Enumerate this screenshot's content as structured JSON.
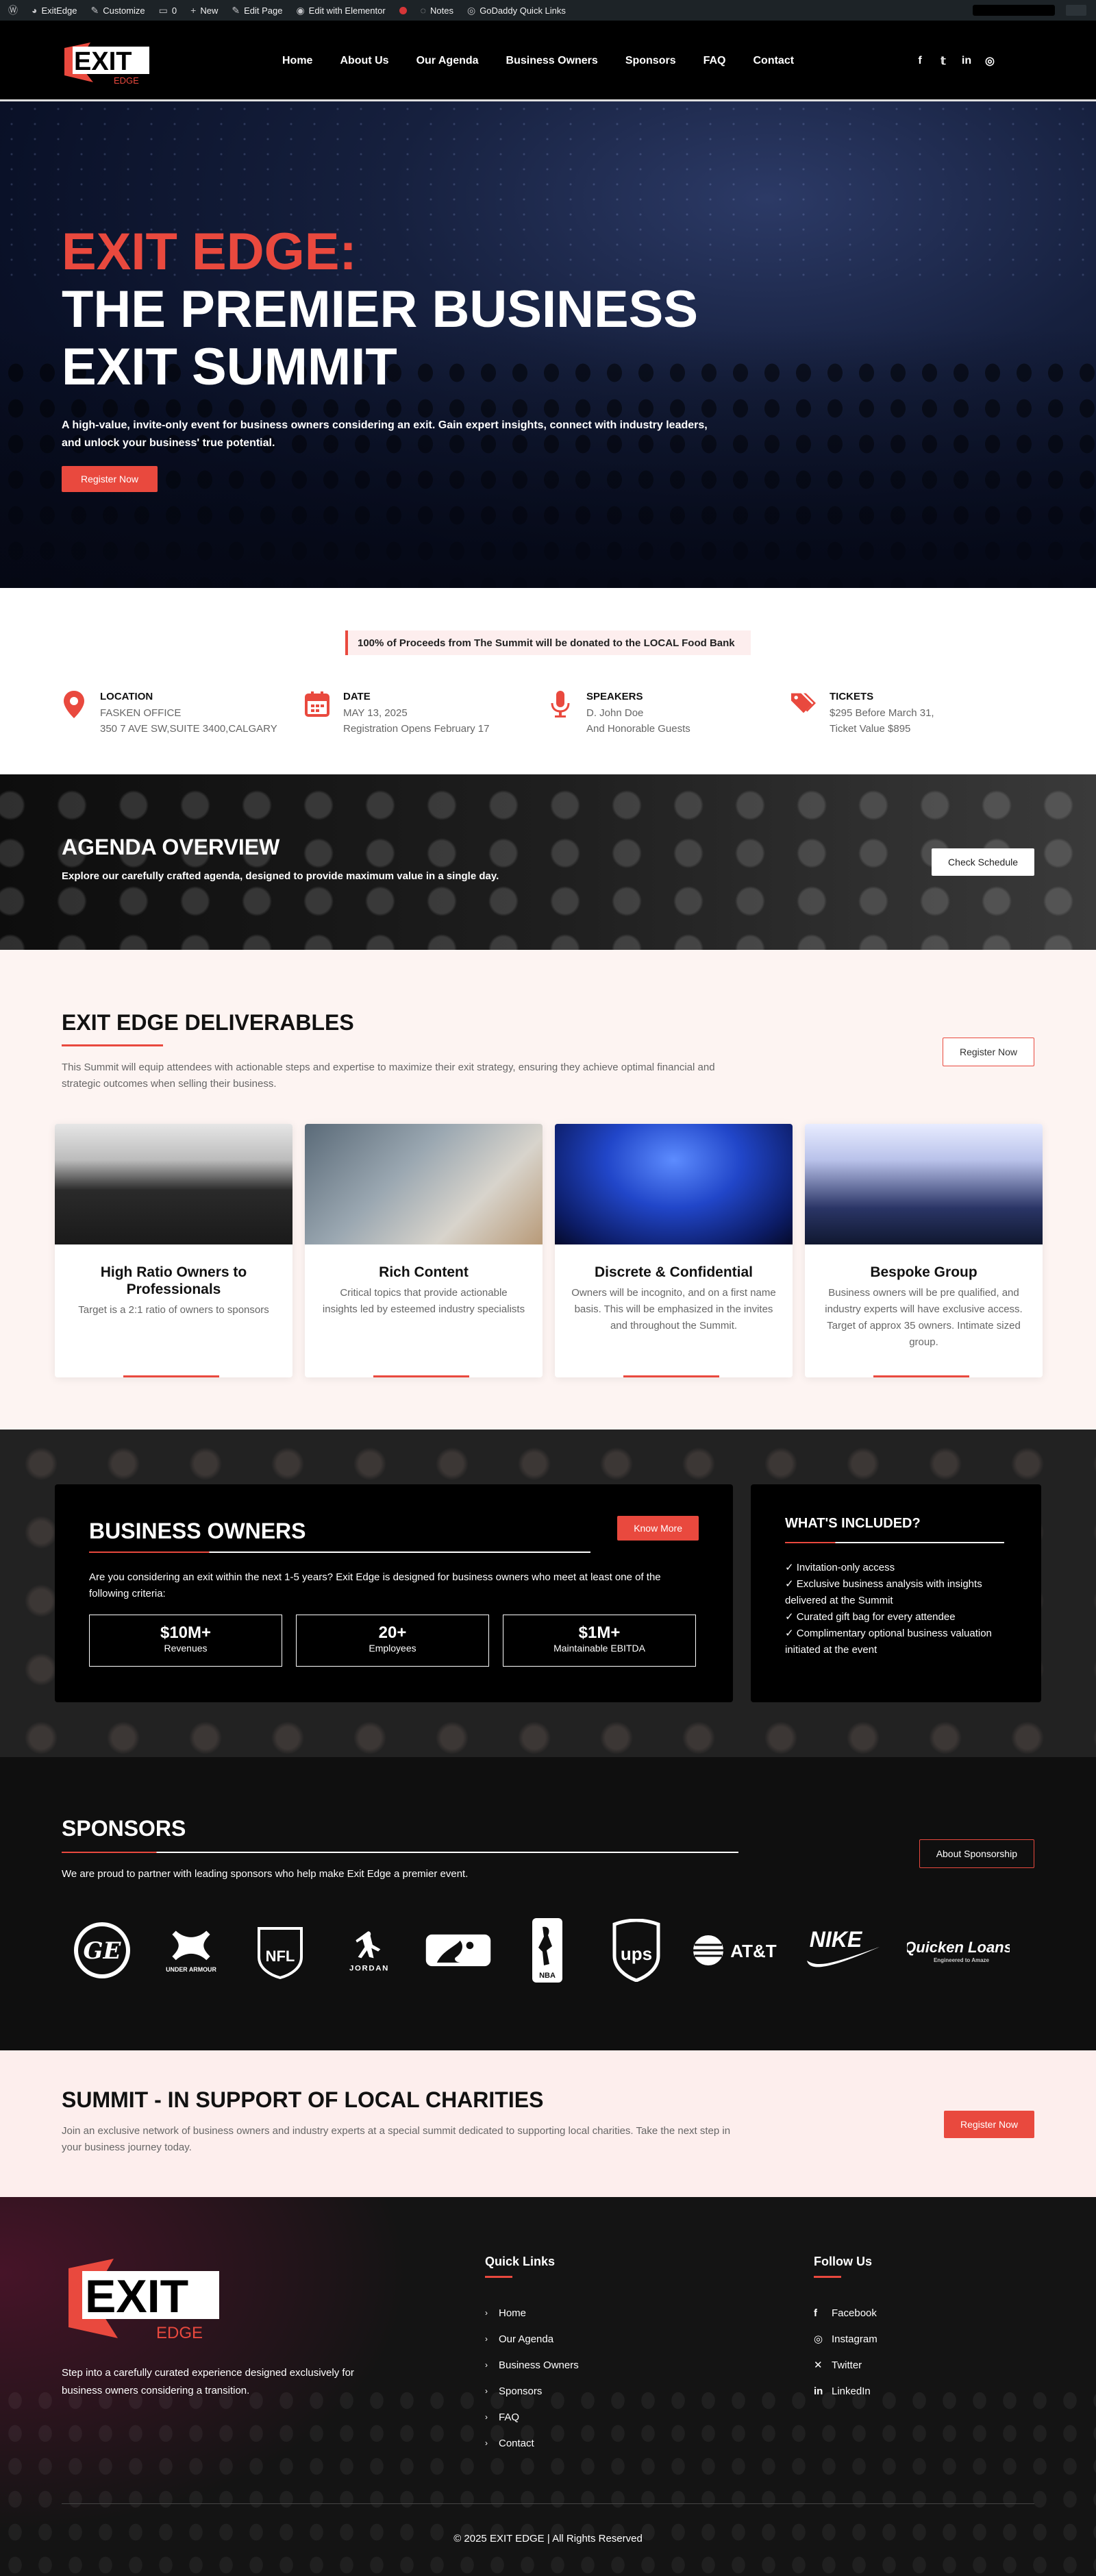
{
  "admin_bar": {
    "site": "ExitEdge",
    "customize": "Customize",
    "comments": "0",
    "new": "New",
    "edit_page": "Edit Page",
    "elementor": "Edit with Elementor",
    "notes": "Notes",
    "quick_links": "GoDaddy Quick Links"
  },
  "header": {
    "logo_main": "EXIT",
    "logo_sub": "EDGE",
    "nav": [
      "Home",
      "About Us",
      "Our Agenda",
      "Business Owners",
      "Sponsors",
      "FAQ",
      "Contact"
    ],
    "social_icons": [
      "facebook-icon",
      "twitter-icon",
      "linkedin-icon",
      "instagram-icon"
    ]
  },
  "hero": {
    "line1": "EXIT EDGE:",
    "line2": "THE PREMIER BUSINESS",
    "line3": "EXIT SUMMIT",
    "description": "A high-value, invite-only event for business owners considering an exit. Gain expert insights, connect with industry leaders, and unlock your business' true potential.",
    "cta": "Register Now"
  },
  "info": {
    "banner": "100% of Proceeds from The Summit will be donated to the LOCAL Food Bank",
    "items": [
      {
        "icon": "location-pin-icon",
        "title": "LOCATION",
        "line1": "FASKEN OFFICE",
        "line2": "350 7 AVE SW,SUITE 3400,CALGARY"
      },
      {
        "icon": "calendar-icon",
        "title": "DATE",
        "line1": "MAY 13, 2025",
        "line2": "Registration Opens February 17"
      },
      {
        "icon": "microphone-icon",
        "title": "SPEAKERS",
        "line1": "D. John Doe",
        "line2": "And Honorable Guests"
      },
      {
        "icon": "tags-icon",
        "title": "TICKETS",
        "line1": "$295 Before March 31,",
        "line2": "Ticket Value $895"
      }
    ]
  },
  "agenda": {
    "title": "AGENDA OVERVIEW",
    "subtitle": "Explore our carefully crafted agenda, designed to provide maximum value in a single day.",
    "cta": "Check Schedule"
  },
  "deliverables": {
    "title": "EXIT EDGE DELIVERABLES",
    "subtitle": "This Summit will equip attendees with actionable steps and expertise to maximize their exit strategy, ensuring they achieve optimal financial and strategic outcomes when selling their business.",
    "cta": "Register Now",
    "cards": [
      {
        "title": "High Ratio Owners to Professionals",
        "desc": "Target is a 2:1 ratio of owners to sponsors",
        "img_color": "#3a3a3a"
      },
      {
        "title": "Rich Content",
        "desc": "Critical topics that provide actionable insights led by esteemed industry specialists",
        "img_color": "#8f9aa3"
      },
      {
        "title": "Discrete & Confidential",
        "desc": "Owners will be incognito, and on a first name basis. This will be emphasized in the invites and throughout the Summit.",
        "img_color": "#1d3a9a"
      },
      {
        "title": "Bespoke Group",
        "desc": "Business owners will be pre qualified, and industry experts will have exclusive access. Target of approx 35 owners. Intimate sized group.",
        "img_color": "#6a7aa6"
      }
    ]
  },
  "owners": {
    "title": "BUSINESS OWNERS",
    "cta": "Know More",
    "desc": "Are you considering an exit within the next 1-5 years? Exit Edge is designed for business owners who meet at least one of the following criteria:",
    "stats": [
      {
        "value": "$10M+",
        "label": "Revenues"
      },
      {
        "value": "20+",
        "label": "Employees"
      },
      {
        "value": "$1M+",
        "label": "Maintainable EBITDA"
      }
    ],
    "included_title": "WHAT'S INCLUDED?",
    "included": [
      "✓ Invitation-only access",
      "✓ Exclusive business analysis with insights delivered at the Summit",
      "✓ Curated gift bag for every attendee",
      "✓ Complimentary optional business valuation initiated at the event"
    ]
  },
  "sponsors": {
    "title": "SPONSORS",
    "subtitle": "We are proud to partner with leading sponsors who help make Exit Edge a premier event.",
    "cta": "About Sponsorship",
    "logos": [
      {
        "icon": "ge-logo",
        "text": "GE"
      },
      {
        "icon": "under-armour-logo",
        "text": "UNDER ARMOUR"
      },
      {
        "icon": "nfl-logo",
        "text": "NFL"
      },
      {
        "icon": "jordan-logo",
        "text": "JORDAN"
      },
      {
        "icon": "mlb-logo",
        "text": ""
      },
      {
        "icon": "nba-logo",
        "text": "NBA"
      },
      {
        "icon": "ups-logo",
        "text": "ups"
      },
      {
        "icon": "att-logo",
        "text": "AT&T"
      },
      {
        "icon": "nike-logo",
        "text": "NIKE"
      },
      {
        "icon": "quicken-loans-logo",
        "text": "Quicken Loans"
      }
    ]
  },
  "charity": {
    "title": "SUMMIT - IN SUPPORT OF LOCAL CHARITIES",
    "desc": "Join an exclusive network of business owners and industry experts at a special summit dedicated to supporting local charities. Take the next step in your business journey today.",
    "cta": "Register Now"
  },
  "footer": {
    "tagline": "Step into a carefully curated experience designed exclusively for business owners considering a transition.",
    "quick_title": "Quick Links",
    "quick_links": [
      "Home",
      "Our Agenda",
      "Business Owners",
      "Sponsors",
      "FAQ",
      "Contact"
    ],
    "follow_title": "Follow Us",
    "follow": [
      {
        "icon": "facebook-icon",
        "label": "Facebook"
      },
      {
        "icon": "instagram-icon",
        "label": "Instagram"
      },
      {
        "icon": "x-icon",
        "label": "Twitter"
      },
      {
        "icon": "linkedin-icon",
        "label": "LinkedIn"
      }
    ],
    "copyright": "© 2025 EXIT EDGE | All Rights Reserved"
  },
  "colors": {
    "accent": "#e9493e",
    "dark": "#000000",
    "blush": "#fdf4f2"
  }
}
